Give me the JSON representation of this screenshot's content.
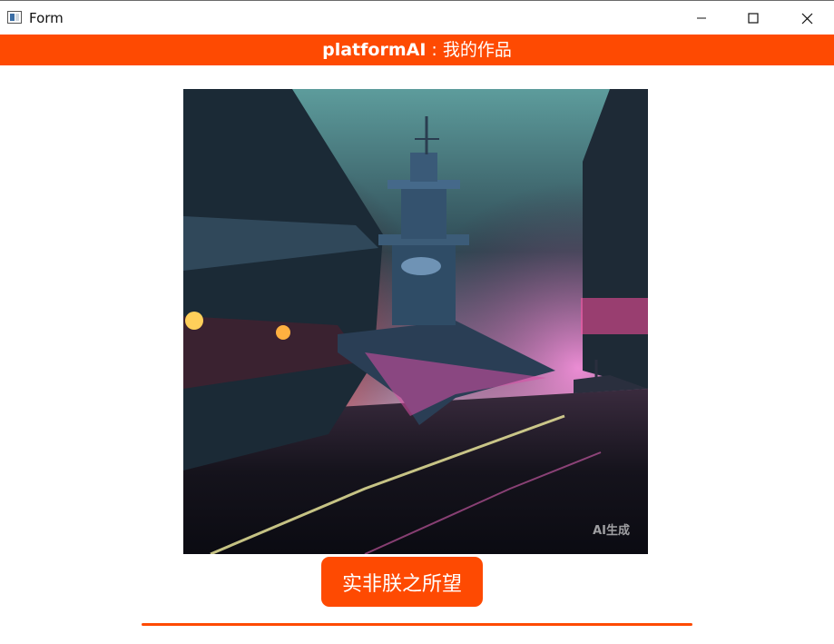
{
  "window": {
    "title": "Form",
    "icon": "app-form-icon",
    "controls": [
      "minimize-icon",
      "maximize-icon",
      "close-icon"
    ]
  },
  "header": {
    "brand": "platformAI",
    "separator": " : ",
    "title": "我的作品",
    "background_color": "#fe4a02"
  },
  "artwork": {
    "watermark": "AI生成"
  },
  "caption_button": {
    "label": "实非朕之所望",
    "color": "#fe4a02"
  },
  "progress": {
    "value": 1.0,
    "color": "#fe4a02"
  }
}
